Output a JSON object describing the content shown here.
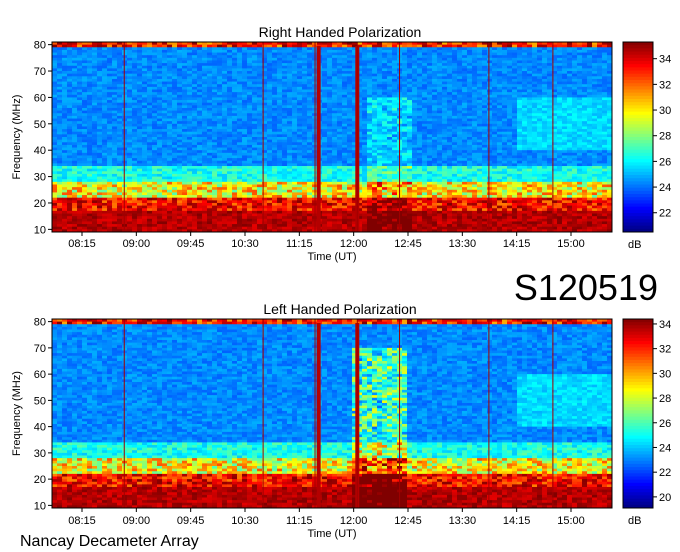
{
  "page": {
    "observation_id": "S120519",
    "instrument": "Nancay Decameter Array"
  },
  "chart_data": [
    {
      "type": "heatmap",
      "title": "Right Handed Polarization",
      "xlabel": "Time (UT)",
      "ylabel": "Frequency (MHz)",
      "x_ticks": [
        "08:15",
        "09:00",
        "09:45",
        "10:30",
        "11:15",
        "12:00",
        "12:45",
        "13:30",
        "14:15",
        "15:00"
      ],
      "y_ticks": [
        10,
        20,
        30,
        40,
        50,
        60,
        70,
        80
      ],
      "ylim": [
        9,
        81
      ],
      "colorbar": {
        "label": "dB",
        "ticks": [
          22,
          24,
          26,
          28,
          30,
          32,
          34
        ],
        "range": [
          20.5,
          35.3
        ]
      },
      "strong_emission_bands_mhz": [
        [
          10,
          28
        ]
      ],
      "bright_features_time_ut": [
        "11:31",
        "12:03"
      ],
      "vertical_lines_time_ut": [
        "08:50",
        "10:45",
        "11:28",
        "12:03",
        "12:38",
        "13:52",
        "14:45"
      ]
    },
    {
      "type": "heatmap",
      "title": "Left Handed Polarization",
      "xlabel": "Time (UT)",
      "ylabel": "Frequency (MHz)",
      "x_ticks": [
        "08:15",
        "09:00",
        "09:45",
        "10:30",
        "11:15",
        "12:00",
        "12:45",
        "13:30",
        "14:15",
        "15:00"
      ],
      "y_ticks": [
        10,
        20,
        30,
        40,
        50,
        60,
        70,
        80
      ],
      "ylim": [
        9,
        81
      ],
      "colorbar": {
        "label": "dB",
        "ticks": [
          20,
          22,
          24,
          26,
          28,
          30,
          32,
          34
        ],
        "range": [
          19.1,
          34.4
        ]
      },
      "strong_emission_bands_mhz": [
        [
          10,
          28
        ]
      ],
      "bright_features_time_ut": [
        "11:31",
        "12:03"
      ],
      "vertical_lines_time_ut": [
        "08:50",
        "10:45",
        "11:28",
        "12:03",
        "12:38",
        "13:52",
        "14:45"
      ]
    }
  ]
}
